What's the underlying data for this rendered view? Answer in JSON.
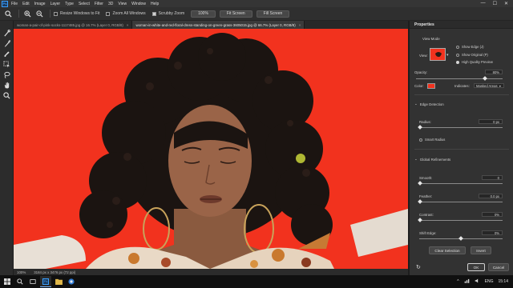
{
  "app": {
    "logo": "Ps"
  },
  "menubar": {
    "items": [
      "File",
      "Edit",
      "Image",
      "Layer",
      "Type",
      "Select",
      "Filter",
      "3D",
      "View",
      "Window",
      "Help"
    ],
    "window_controls": [
      "—",
      "☐",
      "✕"
    ]
  },
  "options": {
    "resize_window": "Resize Windows to Fit",
    "zoom_all": "Zoom All Windows",
    "scrubby_zoom": "Scrubby Zoom",
    "btn_100": "100%",
    "btn_fit": "Fit Screen",
    "btn_fill": "Fill Screen"
  },
  "tabs": [
    {
      "label": "woman-a-pair-of-pink-socks-1117485.jpg @ 16.7% (Layer 0, RGB/8)",
      "active": false
    },
    {
      "label": "woman-in-white-and-red-floral-dress-standing-on-green-grass-3605015.jpg @ 66.7% (Layer 0, RGB/8)",
      "active": true
    }
  ],
  "status": {
    "zoom": "100%",
    "doc_size": "3184 px x 3476 px (72 ppi)"
  },
  "properties": {
    "tab": "Properties",
    "view_mode_label": "View Mode",
    "view_label": "View:",
    "show_edge": "Show Edge (J)",
    "show_original": "Show Original (P)",
    "hq_preview": "High Quality Preview",
    "opacity_label": "Opacity:",
    "opacity_value": "80%",
    "opacity_fraction": 0.8,
    "color_label": "Color:",
    "indicates_label": "Indicates:",
    "indicates_value": "Masked Areas",
    "edge_detection": "Edge Detection",
    "radius_label": "Radius:",
    "radius_value": "0 px",
    "smart_radius": "Smart Radius",
    "global_refinements": "Global Refinements",
    "smooth_label": "Smooth:",
    "smooth_value": "0",
    "feather_label": "Feather:",
    "feather_value": "0.0 px",
    "contrast_label": "Contrast:",
    "contrast_value": "0%",
    "shift_edge_label": "Shift Edge:",
    "shift_edge_value": "0%",
    "clear_selection": "Clear Selection",
    "invert": "Invert",
    "ok": "OK",
    "cancel": "Cancel"
  },
  "taskbar": {
    "lang": "ENG",
    "time": "15:14"
  },
  "colors": {
    "overlay": "#f2321e",
    "panel": "#323232",
    "accent": "#3aa0ff"
  }
}
